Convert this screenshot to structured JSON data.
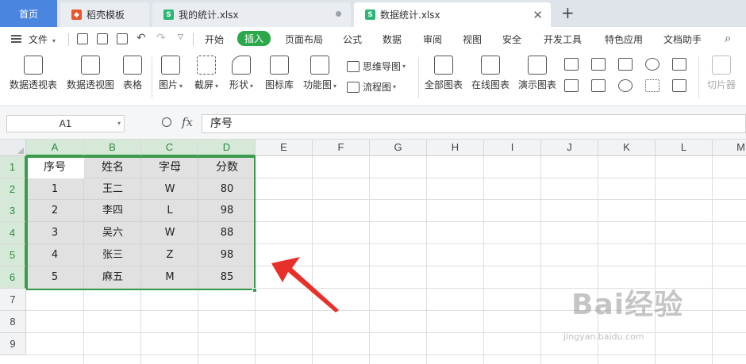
{
  "tabs": [
    {
      "label": "首页"
    },
    {
      "label": "稻壳模板",
      "icon": "docer-icon"
    },
    {
      "label": "我的统计.xlsx",
      "icon": "spreadsheet-icon"
    },
    {
      "label": "数据统计.xlsx",
      "icon": "spreadsheet-icon"
    }
  ],
  "menubar": {
    "file_label": "文件",
    "items": [
      "开始",
      "插入",
      "页面布局",
      "公式",
      "数据",
      "审阅",
      "视图",
      "安全",
      "开发工具",
      "特色应用",
      "文档助手"
    ],
    "active_item": "插入"
  },
  "ribbon": {
    "pivot_table": "数据透视表",
    "pivot_chart": "数据透视图",
    "table": "表格",
    "picture": "图片",
    "screenshot": "截屏",
    "shapes": "形状",
    "icon_library": "图标库",
    "function_chart": "功能图",
    "mind_map": "思维导图",
    "flowchart": "流程图",
    "all_charts": "全部图表",
    "online_charts": "在线图表",
    "demo_charts": "演示图表",
    "slicer": "切片器"
  },
  "formula_bar": {
    "name_box": "A1",
    "fx_label": "fx",
    "value": "序号"
  },
  "sheet": {
    "columns": [
      "A",
      "B",
      "C",
      "D",
      "E",
      "F",
      "G",
      "H",
      "I",
      "J",
      "K",
      "L",
      "M"
    ],
    "rows": [
      "1",
      "2",
      "3",
      "4",
      "5",
      "6",
      "7",
      "8",
      "9"
    ],
    "header": [
      "序号",
      "姓名",
      "字母",
      "分数"
    ],
    "data": [
      [
        "1",
        "王二",
        "W",
        "80"
      ],
      [
        "2",
        "李四",
        "L",
        "98"
      ],
      [
        "3",
        "吴六",
        "W",
        "88"
      ],
      [
        "4",
        "张三",
        "Z",
        "98"
      ],
      [
        "5",
        "麻五",
        "M",
        "85"
      ]
    ]
  },
  "annotation": {
    "arrow_color": "#e8302b"
  },
  "colors": {
    "accent_green": "#2ba84a",
    "selection_border": "#3a9b4d",
    "home_tab": "#4a86e0"
  },
  "watermark": {
    "line1": "Bai经验",
    "line2": "jingyan.baidu.com"
  }
}
